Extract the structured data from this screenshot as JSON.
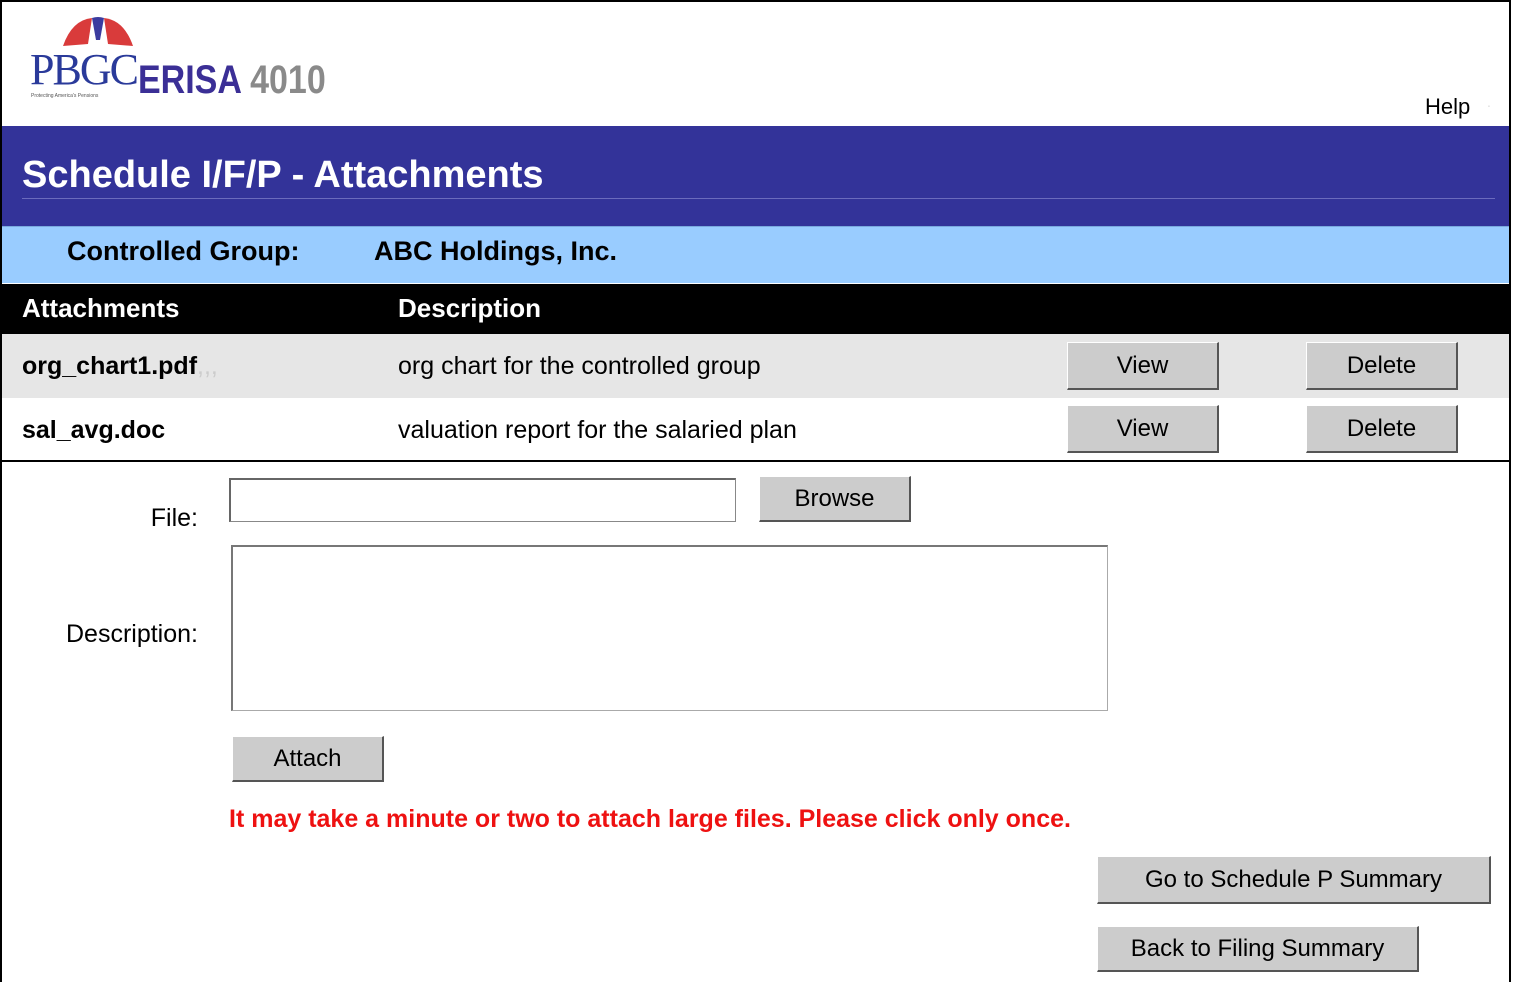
{
  "header": {
    "logo_org": "PBGC",
    "logo_product": "ERISA",
    "logo_product_number": "4010",
    "logo_tagline": "Protecting America's Pensions",
    "help_label": "Help"
  },
  "page": {
    "title": "Schedule I/F/P - Attachments"
  },
  "controlled_group": {
    "label": "Controlled Group:",
    "value": "ABC Holdings, Inc."
  },
  "attachments_table": {
    "columns": [
      "Attachments",
      "Description"
    ],
    "rows": [
      {
        "name": "org_chart1.pdf",
        "description": "org chart for the controlled group",
        "view_label": "View",
        "delete_label": "Delete"
      },
      {
        "name": "sal_avg.doc",
        "description": "valuation report for the salaried plan",
        "view_label": "View",
        "delete_label": "Delete"
      }
    ]
  },
  "form": {
    "file_label": "File:",
    "file_value": "",
    "browse_label": "Browse",
    "description_label": "Description:",
    "description_value": "",
    "attach_label": "Attach",
    "warning": "It may take a minute or two to attach large files. Please click only once."
  },
  "navigation": {
    "schedule_summary_label": "Go  to Schedule P  Summary",
    "filing_summary_label": "Back to Filing Summary"
  },
  "colors": {
    "title_bar": "#333399",
    "group_bar": "#99ccff",
    "table_header": "#000000",
    "row_alt": "#e6e6e6",
    "warning": "#ee1111",
    "button": "#cccccc"
  }
}
